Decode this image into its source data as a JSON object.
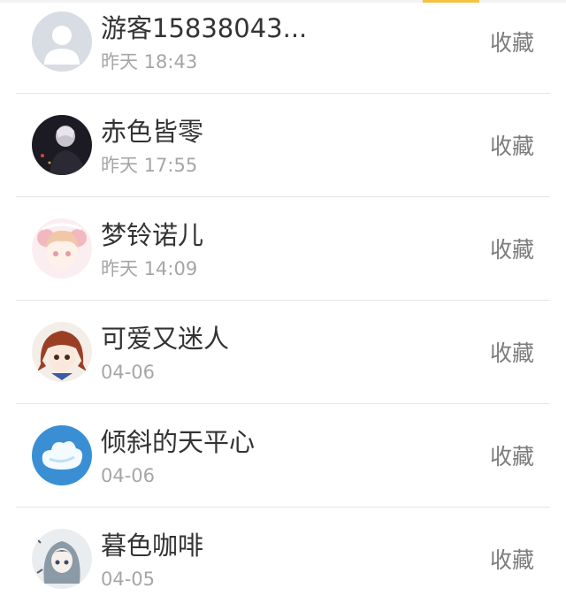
{
  "users": [
    {
      "name": "游客15838043...",
      "time": "昨天 18:43",
      "action": "收藏",
      "avatar": "default-user-avatar"
    },
    {
      "name": "赤色皆零",
      "time": "昨天 17:55",
      "action": "收藏",
      "avatar": "dark-photo-avatar"
    },
    {
      "name": "梦铃诺儿",
      "time": "昨天 14:09",
      "action": "收藏",
      "avatar": "pink-anime-avatar"
    },
    {
      "name": "可爱又迷人",
      "time": "04-06",
      "action": "收藏",
      "avatar": "brown-hair-anime-avatar"
    },
    {
      "name": "倾斜的天平心",
      "time": "04-06",
      "action": "收藏",
      "avatar": "cloud-sky-avatar"
    },
    {
      "name": "暮色咖啡",
      "time": "04-05",
      "action": "收藏",
      "avatar": "gray-anime-avatar"
    }
  ],
  "colors": {
    "name": "#333333",
    "time": "#a6a6a6",
    "action": "#7c7c7c",
    "divider": "#e6e6e6",
    "accent": "#f5c242"
  }
}
